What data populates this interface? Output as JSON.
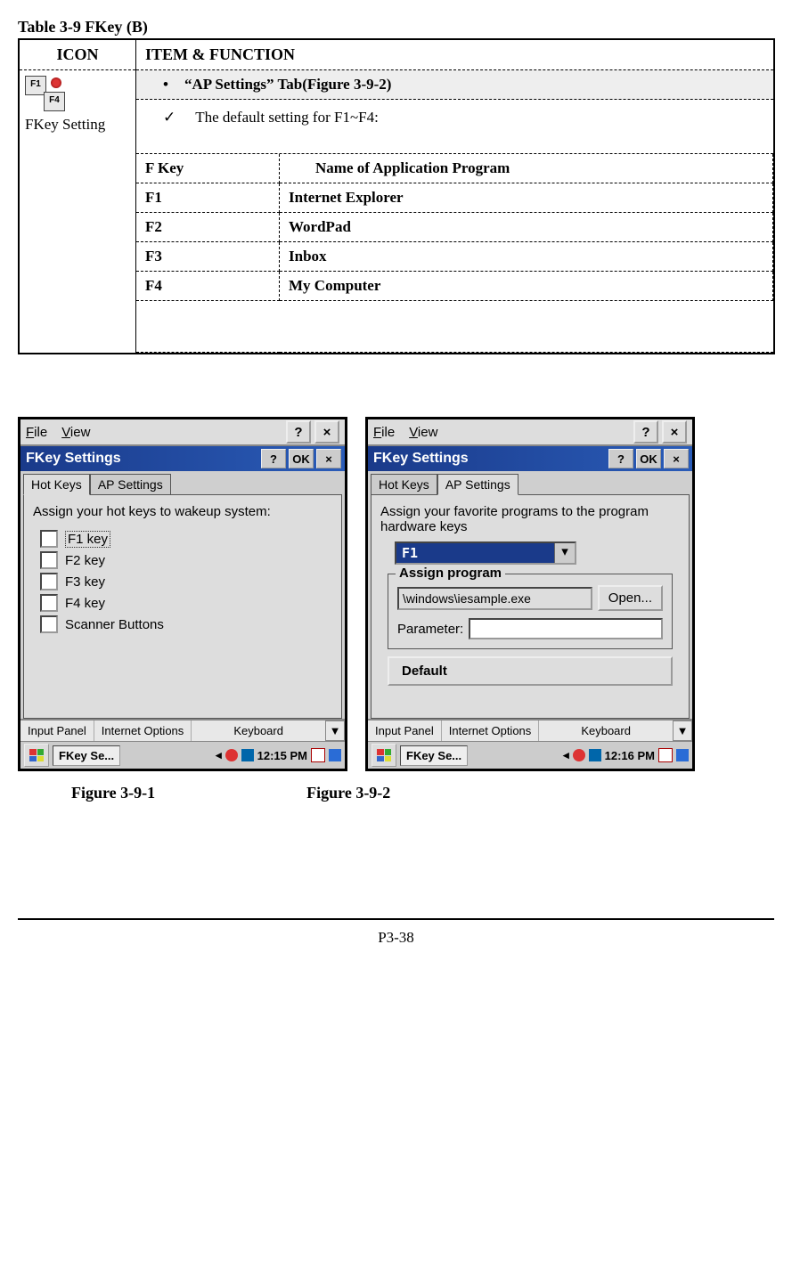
{
  "table_caption": "Table 3-9 FKey (B)",
  "headers": {
    "icon": "ICON",
    "item": "ITEM & FUNCTION"
  },
  "icon_cell": {
    "k1": "F1",
    "k2": "F4",
    "label": "FKey Setting"
  },
  "ap_header": "“AP Settings” Tab(Figure 3-9-2)",
  "default_line": "The default setting for F1~F4:",
  "inner_headers": {
    "fkey": "F Key",
    "name": "Name of Application Program"
  },
  "rows": [
    {
      "key": "F1",
      "app": "Internet Explorer"
    },
    {
      "key": "F2",
      "app": "WordPad"
    },
    {
      "key": "F3",
      "app": "Inbox"
    },
    {
      "key": "F4",
      "app": "My Computer"
    }
  ],
  "menubar": {
    "file": "File",
    "view": "View",
    "help": "?",
    "close": "×"
  },
  "titlebar": {
    "title": "FKey Settings",
    "help": "?",
    "ok": "OK",
    "close": "×"
  },
  "tabs": {
    "hotkeys": "Hot Keys",
    "apsettings": "AP Settings"
  },
  "shot1": {
    "desc": "Assign your hot keys to wakeup system:",
    "checks": [
      "F1 key",
      "F2 key",
      "F3 key",
      "F4 key",
      "Scanner Buttons"
    ]
  },
  "shot2": {
    "desc": "Assign your favorite programs to the program hardware keys",
    "dropdown_val": "F1",
    "group_legend": "Assign program",
    "path": "\\windows\\iesample.exe",
    "open_btn": "Open...",
    "param_label": "Parameter:",
    "default_btn": "Default"
  },
  "bottombar": {
    "input": "Input Panel",
    "inet": "Internet Options",
    "kb": "Keyboard",
    "arrow": "▼"
  },
  "taskbar": {
    "task_label": "FKey Se...",
    "arrow_left": "◂",
    "time1": "12:15 PM",
    "time2": "12:16 PM"
  },
  "figures": {
    "f1": "Figure 3-9-1",
    "f2": "Figure 3-9-2"
  },
  "page_num": "P3-38"
}
